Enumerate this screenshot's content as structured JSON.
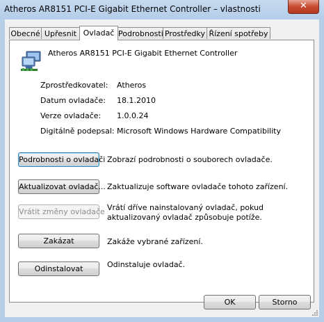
{
  "window": {
    "title": "Atheros AR8151 PCI-E Gigabit Ethernet Controller – vlastnosti",
    "close_symbol": "✕"
  },
  "tabs": [
    {
      "label": "Obecné"
    },
    {
      "label": "Upřesnit"
    },
    {
      "label": "Ovladač",
      "active": true
    },
    {
      "label": "Podrobnosti"
    },
    {
      "label": "Prostředky"
    },
    {
      "label": "Řízení spotřeby"
    }
  ],
  "device": {
    "name": "Atheros AR8151 PCI-E Gigabit Ethernet Controller",
    "icon": "network-adapter-icon"
  },
  "info": {
    "provider_label": "Zprostředkovatel:",
    "provider_value": "Atheros",
    "date_label": "Datum ovladače:",
    "date_value": "18.1.2010",
    "version_label": "Verze ovladače:",
    "version_value": "1.0.0.24",
    "signer_label": "Digitálně podepsal:",
    "signer_value": "Microsoft Windows Hardware Compatibility"
  },
  "actions": {
    "details_label": "Podrobnosti o ovladači",
    "details_desc": "Zobrazí podrobnosti o souborech ovladače.",
    "update_label": "Aktualizovat ovladač...",
    "update_desc": "Zaktualizuje software ovladače tohoto zařízení.",
    "rollback_label": "Vrátit změny ovladače",
    "rollback_desc": "Vrátí dříve nainstalovaný ovladač, pokud aktualizovaný ovladač způsobuje potíže.",
    "disable_label": "Zakázat",
    "disable_desc": "Zakáže vybrané zařízení.",
    "uninstall_label": "Odinstalovat",
    "uninstall_desc": "Odinstaluje ovladač."
  },
  "footer": {
    "ok_label": "OK",
    "cancel_label": "Storno"
  },
  "colors": {
    "titlebar": "#b4cde9",
    "close": "#c74a30",
    "focus_border": "#3c7fb1"
  }
}
